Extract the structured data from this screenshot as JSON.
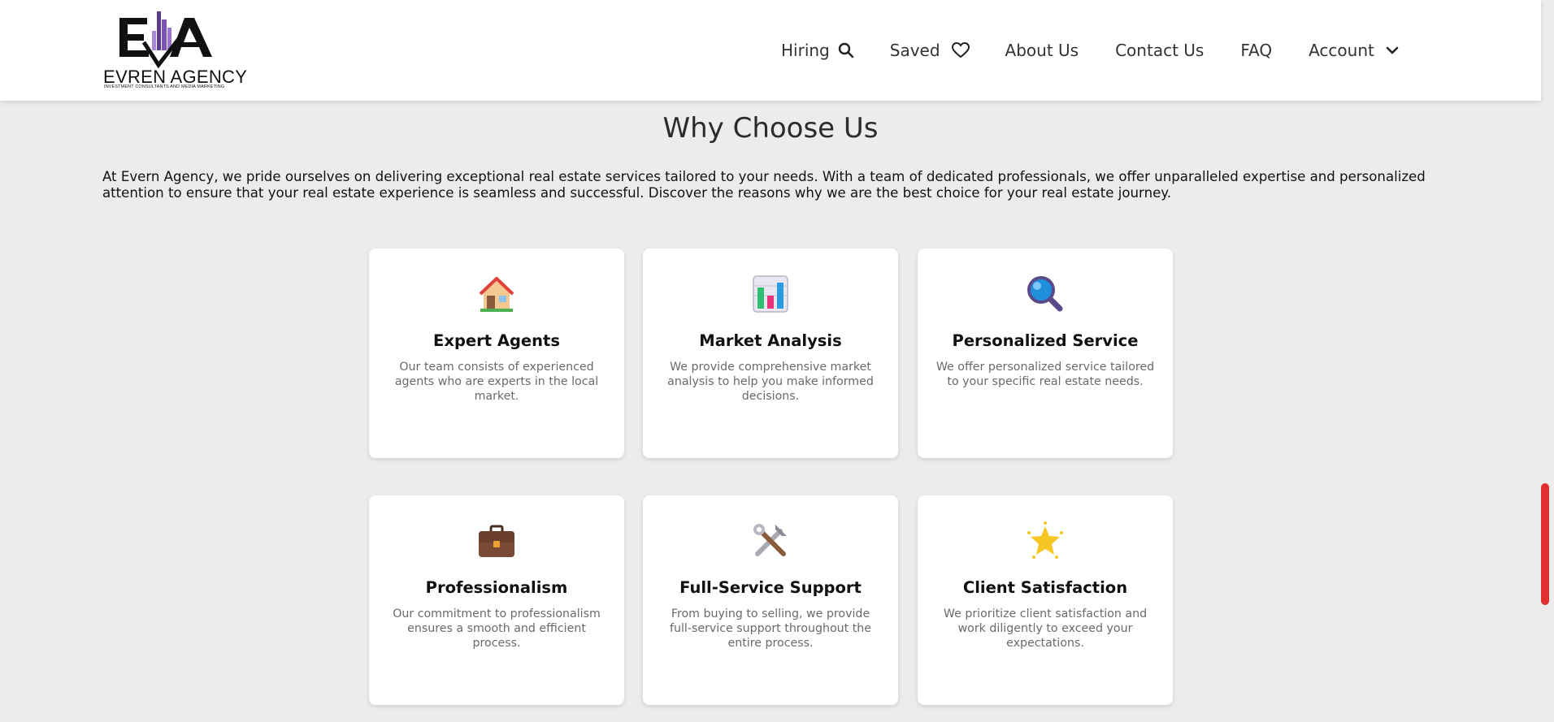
{
  "brand": {
    "logo_mark": "EA",
    "name": "EVREN AGENCY",
    "tagline": "INVESTMENT CONSULTANTS AND MEDIA MARKETING"
  },
  "nav": {
    "hiring": "Hiring",
    "saved": "Saved",
    "about": "About Us",
    "contact": "Contact Us",
    "faq": "FAQ",
    "account": "Account"
  },
  "section": {
    "title": "Why Choose Us",
    "intro": "At Evern Agency, we pride ourselves on delivering exceptional real estate services tailored to your needs. With a team of dedicated professionals, we offer unparalleled expertise and personalized attention to ensure that your real estate experience is seamless and successful. Discover the reasons why we are the best choice for your real estate journey."
  },
  "cards": [
    {
      "icon": "house-icon",
      "title": "Expert Agents",
      "text": "Our team consists of experienced agents who are experts in the local market."
    },
    {
      "icon": "bar-chart-icon",
      "title": "Market Analysis",
      "text": "We provide comprehensive market analysis to help you make informed decisions."
    },
    {
      "icon": "magnifier-icon",
      "title": "Personalized Service",
      "text": "We offer personalized service tailored to your specific real estate needs."
    },
    {
      "icon": "briefcase-icon",
      "title": "Professionalism",
      "text": "Our commitment to professionalism ensures a smooth and efficient process."
    },
    {
      "icon": "tools-icon",
      "title": "Full-Service Support",
      "text": "From buying to selling, we provide full-service support throughout the entire process."
    },
    {
      "icon": "star-icon",
      "title": "Client Satisfaction",
      "text": "We prioritize client satisfaction and work diligently to exceed your expectations."
    }
  ],
  "colors": {
    "page_bg": "#ececec",
    "brand_purple": "#6a3fa0",
    "scrollbar": "#e03030"
  }
}
